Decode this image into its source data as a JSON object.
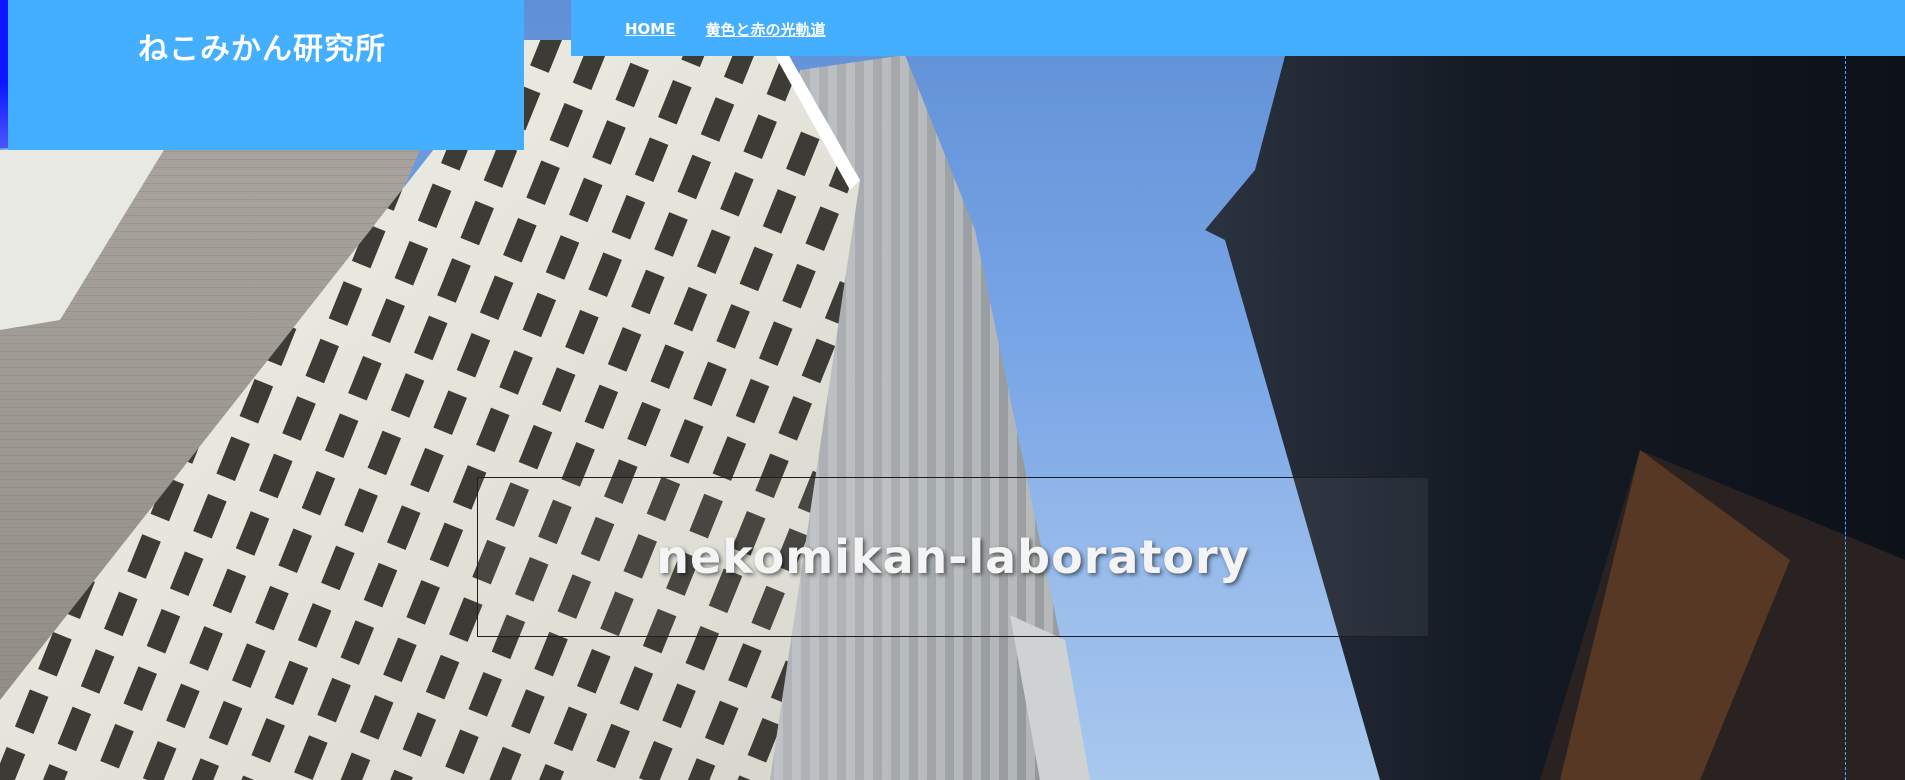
{
  "site": {
    "title": "ねこみかん研究所"
  },
  "nav": {
    "items": [
      {
        "label": "HOME"
      },
      {
        "label": "黄色と赤の光軌道"
      }
    ]
  },
  "hero": {
    "headline": "nekomikan-laboratory"
  },
  "colors": {
    "brand_blue": "#44aeff",
    "accent_blue": "#0a16ff",
    "guide_line": "#4aa6ff",
    "headline_text": "#f4f4f4"
  }
}
